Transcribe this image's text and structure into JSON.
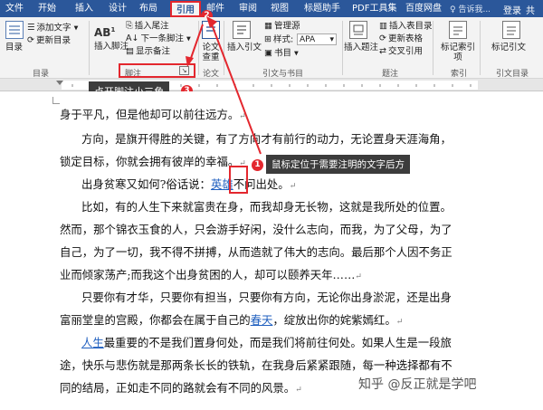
{
  "menubar": {
    "tabs": [
      "文件",
      "开始",
      "插入",
      "设计",
      "布局",
      "引用",
      "邮件",
      "审阅",
      "视图",
      "标题助手",
      "PDF工具集",
      "百度网盘"
    ],
    "active_tab": "引用",
    "tell_me": "告诉我...",
    "login": "登录",
    "share": "共"
  },
  "ribbon": {
    "toc": {
      "directory": "目录",
      "add_text": "添加文字",
      "update_toc": "更新目录",
      "group_label": "目录"
    },
    "footnotes": {
      "insert_footnote": "插入脚注",
      "insert_endnote": "插入尾注",
      "next_footnote": "下一条脚注",
      "show_notes": "显示备注",
      "group_label": "脚注"
    },
    "research": {
      "paper_check": "论文查重",
      "group_label": "论文"
    },
    "citations": {
      "insert_citation": "插入引文",
      "manage_sources": "管理源",
      "style_label": "样式:",
      "style_value": "APA",
      "bibliography": "书目",
      "group_label": "引文与书目"
    },
    "captions": {
      "insert_caption": "插入题注",
      "insert_table_of_figures": "插入表目录",
      "update_table": "更新表格",
      "cross_reference": "交叉引用",
      "group_label": "题注"
    },
    "index": {
      "mark_entry": "标记索引项",
      "group_label": "索引"
    },
    "authorities": {
      "mark_citation": "标记引文",
      "group_label": "引文目录"
    }
  },
  "document": {
    "lines": [
      "身于平凡，但是他却可以前往远方。",
      "方向，是旗开得胜的关键，有了方向才有前行的动力，无论置身天涯海角，",
      "锁定目标，你就会拥有彼岸的幸福。",
      "出身贫寒又如何?俗话说：",
      "英雄",
      "不问出处。",
      "比如，有的人生下来就富贵在身，而我却身无长物，这就是我所处的位置。",
      "然而，那个锦衣玉食的人，只会游手好闲，没什么志向，而我，为了父母，为了",
      "自己，为了一切，我不得不拼搏，从而造就了伟大的志向。最后那个人因不务正",
      "业而倾家荡产;而我这个出身贫困的人，却可以颐养天年……",
      "只要你有才华，只要你有担当，只要你有方向，无论你出身淤泥，还是出身",
      "富丽堂皇的宫殿，你都会在属于自己的",
      "春天",
      "，绽放出你的姹紫嫣红。",
      "人生",
      "最重要的不是我们置身何处，而是我们将前往何处。如果人生是一段旅",
      "途，快乐与悲伤就是那两条长长的铁轨，在我身后紧紧跟随，每一种选择都有不",
      "同的结局，正如走不同的路就会有不同的风景。"
    ]
  },
  "callouts": {
    "step1": "鼠标定位于需要注明的文字后方",
    "step3": "点开脚注小三角",
    "badge1": "1",
    "badge2": "2",
    "badge3": "3"
  },
  "watermark": "知乎 @反正就是学吧",
  "colors": {
    "ribbon_blue": "#2b579a",
    "highlight_red": "#e3272e",
    "link_blue": "#1f5fbf"
  }
}
